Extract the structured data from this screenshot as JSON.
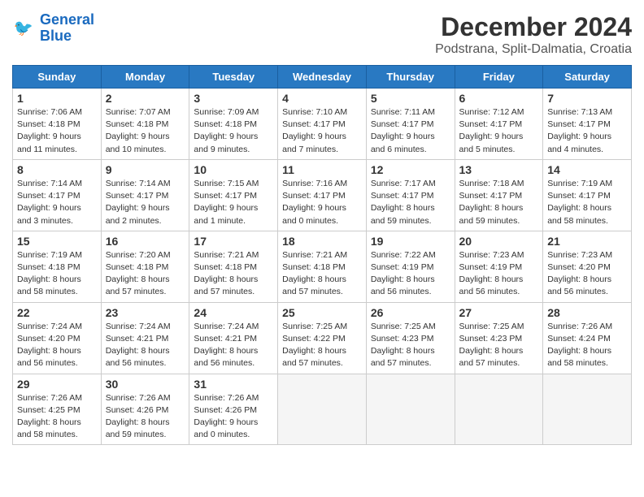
{
  "header": {
    "logo_line1": "General",
    "logo_line2": "Blue",
    "month_title": "December 2024",
    "location": "Podstrana, Split-Dalmatia, Croatia"
  },
  "weekdays": [
    "Sunday",
    "Monday",
    "Tuesday",
    "Wednesday",
    "Thursday",
    "Friday",
    "Saturday"
  ],
  "days": [
    {
      "date": "1",
      "sunrise": "7:06 AM",
      "sunset": "4:18 PM",
      "daylight": "9 hours and 11 minutes."
    },
    {
      "date": "2",
      "sunrise": "7:07 AM",
      "sunset": "4:18 PM",
      "daylight": "9 hours and 10 minutes."
    },
    {
      "date": "3",
      "sunrise": "7:09 AM",
      "sunset": "4:18 PM",
      "daylight": "9 hours and 9 minutes."
    },
    {
      "date": "4",
      "sunrise": "7:10 AM",
      "sunset": "4:17 PM",
      "daylight": "9 hours and 7 minutes."
    },
    {
      "date": "5",
      "sunrise": "7:11 AM",
      "sunset": "4:17 PM",
      "daylight": "9 hours and 6 minutes."
    },
    {
      "date": "6",
      "sunrise": "7:12 AM",
      "sunset": "4:17 PM",
      "daylight": "9 hours and 5 minutes."
    },
    {
      "date": "7",
      "sunrise": "7:13 AM",
      "sunset": "4:17 PM",
      "daylight": "9 hours and 4 minutes."
    },
    {
      "date": "8",
      "sunrise": "7:14 AM",
      "sunset": "4:17 PM",
      "daylight": "9 hours and 3 minutes."
    },
    {
      "date": "9",
      "sunrise": "7:14 AM",
      "sunset": "4:17 PM",
      "daylight": "9 hours and 2 minutes."
    },
    {
      "date": "10",
      "sunrise": "7:15 AM",
      "sunset": "4:17 PM",
      "daylight": "9 hours and 1 minute."
    },
    {
      "date": "11",
      "sunrise": "7:16 AM",
      "sunset": "4:17 PM",
      "daylight": "9 hours and 0 minutes."
    },
    {
      "date": "12",
      "sunrise": "7:17 AM",
      "sunset": "4:17 PM",
      "daylight": "8 hours and 59 minutes."
    },
    {
      "date": "13",
      "sunrise": "7:18 AM",
      "sunset": "4:17 PM",
      "daylight": "8 hours and 59 minutes."
    },
    {
      "date": "14",
      "sunrise": "7:19 AM",
      "sunset": "4:17 PM",
      "daylight": "8 hours and 58 minutes."
    },
    {
      "date": "15",
      "sunrise": "7:19 AM",
      "sunset": "4:18 PM",
      "daylight": "8 hours and 58 minutes."
    },
    {
      "date": "16",
      "sunrise": "7:20 AM",
      "sunset": "4:18 PM",
      "daylight": "8 hours and 57 minutes."
    },
    {
      "date": "17",
      "sunrise": "7:21 AM",
      "sunset": "4:18 PM",
      "daylight": "8 hours and 57 minutes."
    },
    {
      "date": "18",
      "sunrise": "7:21 AM",
      "sunset": "4:18 PM",
      "daylight": "8 hours and 57 minutes."
    },
    {
      "date": "19",
      "sunrise": "7:22 AM",
      "sunset": "4:19 PM",
      "daylight": "8 hours and 56 minutes."
    },
    {
      "date": "20",
      "sunrise": "7:23 AM",
      "sunset": "4:19 PM",
      "daylight": "8 hours and 56 minutes."
    },
    {
      "date": "21",
      "sunrise": "7:23 AM",
      "sunset": "4:20 PM",
      "daylight": "8 hours and 56 minutes."
    },
    {
      "date": "22",
      "sunrise": "7:24 AM",
      "sunset": "4:20 PM",
      "daylight": "8 hours and 56 minutes."
    },
    {
      "date": "23",
      "sunrise": "7:24 AM",
      "sunset": "4:21 PM",
      "daylight": "8 hours and 56 minutes."
    },
    {
      "date": "24",
      "sunrise": "7:24 AM",
      "sunset": "4:21 PM",
      "daylight": "8 hours and 56 minutes."
    },
    {
      "date": "25",
      "sunrise": "7:25 AM",
      "sunset": "4:22 PM",
      "daylight": "8 hours and 57 minutes."
    },
    {
      "date": "26",
      "sunrise": "7:25 AM",
      "sunset": "4:23 PM",
      "daylight": "8 hours and 57 minutes."
    },
    {
      "date": "27",
      "sunrise": "7:25 AM",
      "sunset": "4:23 PM",
      "daylight": "8 hours and 57 minutes."
    },
    {
      "date": "28",
      "sunrise": "7:26 AM",
      "sunset": "4:24 PM",
      "daylight": "8 hours and 58 minutes."
    },
    {
      "date": "29",
      "sunrise": "7:26 AM",
      "sunset": "4:25 PM",
      "daylight": "8 hours and 58 minutes."
    },
    {
      "date": "30",
      "sunrise": "7:26 AM",
      "sunset": "4:26 PM",
      "daylight": "8 hours and 59 minutes."
    },
    {
      "date": "31",
      "sunrise": "7:26 AM",
      "sunset": "4:26 PM",
      "daylight": "9 hours and 0 minutes."
    }
  ]
}
